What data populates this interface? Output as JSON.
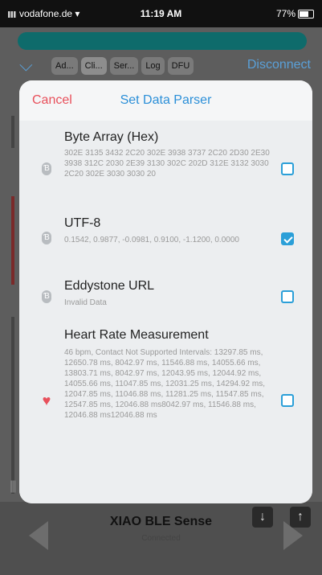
{
  "status_bar": {
    "carrier": "vodafone.de",
    "time": "11:19 AM",
    "battery": "77%"
  },
  "background": {
    "tabs": [
      "Ad...",
      "Cli...",
      "Ser...",
      "Log",
      "DFU"
    ],
    "active_tab": "Cli...",
    "disconnect_label": "Disconnect",
    "device_name": "XIAO BLE Sense",
    "device_status": "Connected"
  },
  "modal": {
    "cancel_label": "Cancel",
    "title": "Set Data Parser",
    "parsers": [
      {
        "name": "Byte Array (Hex)",
        "icon": "bluetooth-icon",
        "value": "302E 3135 3432 2C20 302E 3938 3737 2C20 2D30 2E30 3938 312C 2030 2E39 3130 302C 202D 312E 3132 3030 2C20 302E 3030 3030 20",
        "checked": false
      },
      {
        "name": "UTF-8",
        "icon": "bluetooth-icon",
        "value": "0.1542, 0.9877, -0.0981, 0.9100, -1.1200, 0.0000",
        "checked": true
      },
      {
        "name": "Eddystone URL",
        "icon": "bluetooth-icon",
        "value": "Invalid Data",
        "checked": false
      },
      {
        "name": "Heart Rate Measurement",
        "icon": "heart-icon",
        "value": "46 bpm, Contact Not Supported Intervals: 13297.85 ms, 12650.78 ms, 8042.97 ms, 11546.88 ms, 14055.66 ms, 13803.71 ms, 8042.97 ms, 12043.95 ms, 12044.92 ms, 14055.66 ms, 11047.85 ms, 12031.25 ms, 14294.92 ms, 12047.85 ms, 11046.88 ms, 11281.25 ms, 11547.85 ms, 12547.85 ms, 12046.88 ms8042.97 ms, 11546.88 ms, 12046.88 ms12046.88 ms",
        "checked": false
      }
    ]
  },
  "colors": {
    "accent": "#2b9fd8",
    "cancel": "#e8505b",
    "heart": "#e8505b"
  }
}
